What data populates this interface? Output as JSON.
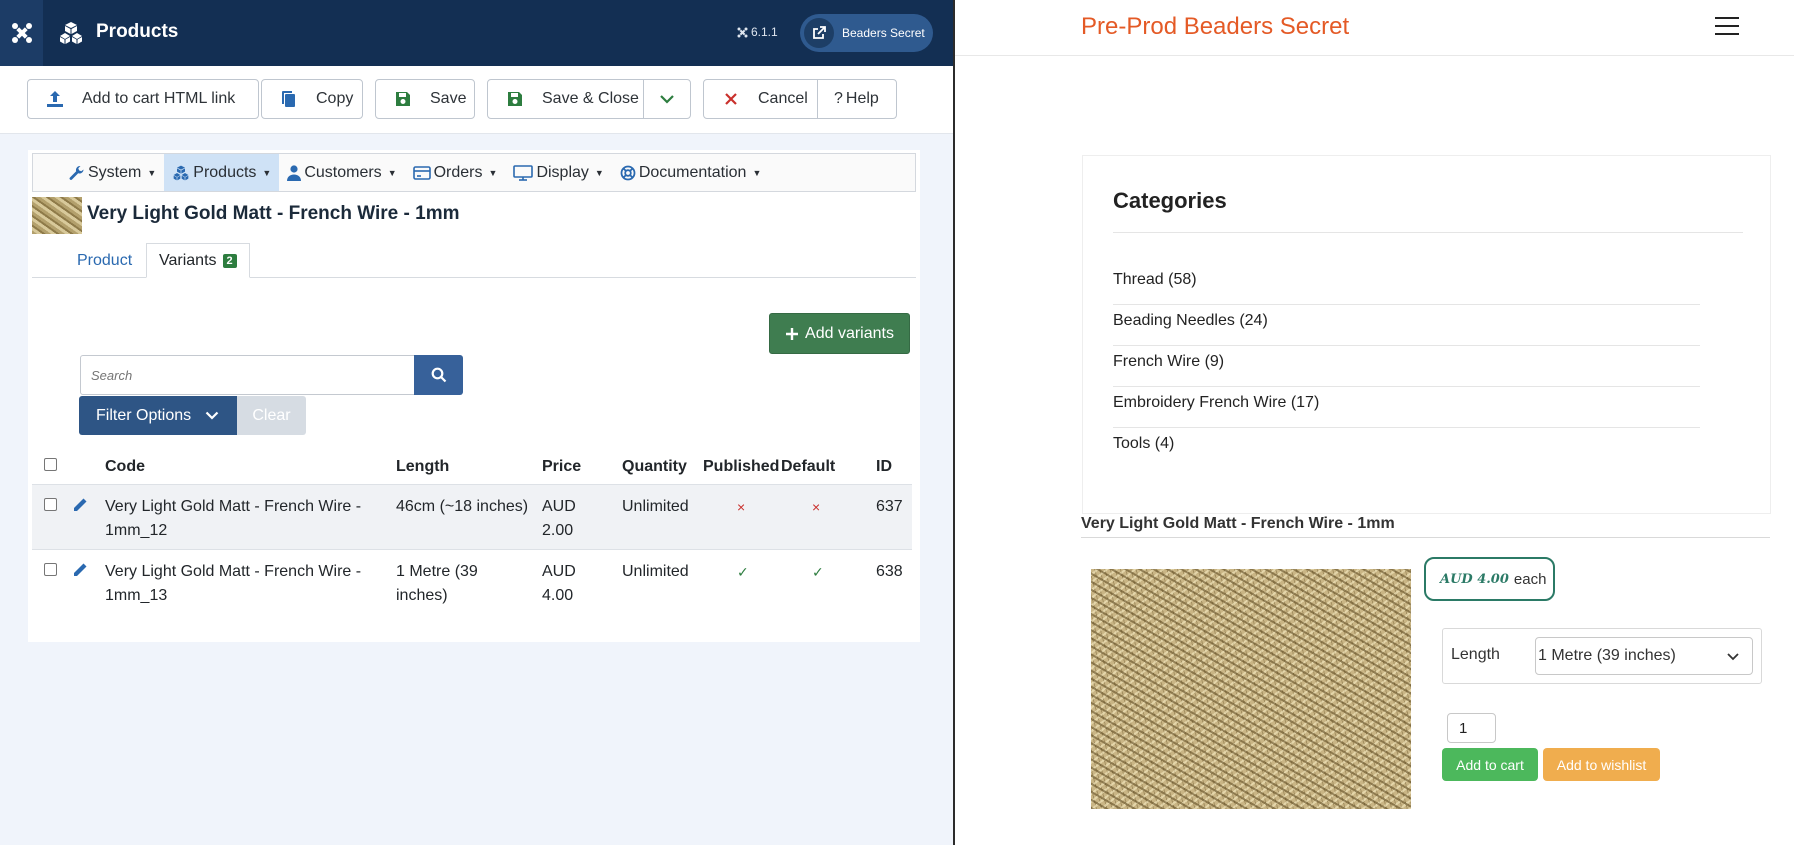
{
  "admin": {
    "header": {
      "title": "Products",
      "version": "6.1.1",
      "site_button_label": "Beaders Secret"
    },
    "toolbar": {
      "add_to_cart_link_label": "Add to cart HTML link",
      "copy_label": "Copy",
      "save_label": "Save",
      "save_close_label": "Save & Close",
      "cancel_label": "Cancel",
      "help_label": "Help"
    },
    "subnav": {
      "items": [
        {
          "label": "System"
        },
        {
          "label": "Products"
        },
        {
          "label": "Customers"
        },
        {
          "label": "Orders"
        },
        {
          "label": "Display"
        },
        {
          "label": "Documentation"
        }
      ]
    },
    "product_title": "Very Light Gold Matt - French Wire - 1mm",
    "tabs": {
      "product_label": "Product",
      "variants_label": "Variants",
      "variants_count": "2"
    },
    "add_variants_label": "Add variants",
    "search": {
      "placeholder": "Search"
    },
    "filter_options_label": "Filter Options",
    "clear_label": "Clear",
    "table": {
      "headers": {
        "code": "Code",
        "length": "Length",
        "price": "Price",
        "quantity": "Quantity",
        "published": "Published",
        "default": "Default",
        "id": "ID"
      },
      "rows": [
        {
          "code_line1": "Very Light Gold Matt - French Wire -",
          "code_line2": "1mm_12",
          "length_line1": "46cm (~18 inches)",
          "length_line2": "",
          "price_line1": "AUD",
          "price_line2": "2.00",
          "quantity": "Unlimited",
          "published": "×",
          "default": "×",
          "id": "637"
        },
        {
          "code_line1": "Very Light Gold Matt - French Wire -",
          "code_line2": "1mm_13",
          "length_line1": "1 Metre (39",
          "length_line2": "inches)",
          "price_line1": "AUD",
          "price_line2": "4.00",
          "quantity": "Unlimited",
          "published": "✓",
          "default": "✓",
          "id": "638"
        }
      ]
    }
  },
  "store": {
    "site_title": "Pre-Prod Beaders Secret",
    "categories": {
      "title": "Categories",
      "items": [
        {
          "label": "Thread (58)"
        },
        {
          "label": "Beading Needles (24)"
        },
        {
          "label": "French Wire (9)"
        },
        {
          "label": "Embroidery French Wire (17)"
        },
        {
          "label": "Tools (4)"
        }
      ]
    },
    "product": {
      "title": "Very Light Gold Matt - French Wire - 1mm",
      "price": "AUD 4.00",
      "price_suffix": "each",
      "length_label": "Length",
      "length_selected": "1 Metre (39 inches)",
      "quantity": "1",
      "add_to_cart_label": "Add to cart",
      "add_to_wishlist_label": "Add to wishlist"
    }
  },
  "colors": {
    "admin_header": "#132f53",
    "accent_blue": "#2e5585",
    "green": "#3f7d50",
    "store_title": "#e45a26",
    "cart_green": "#4cb85c",
    "wishlist_orange": "#f0ad4e"
  }
}
